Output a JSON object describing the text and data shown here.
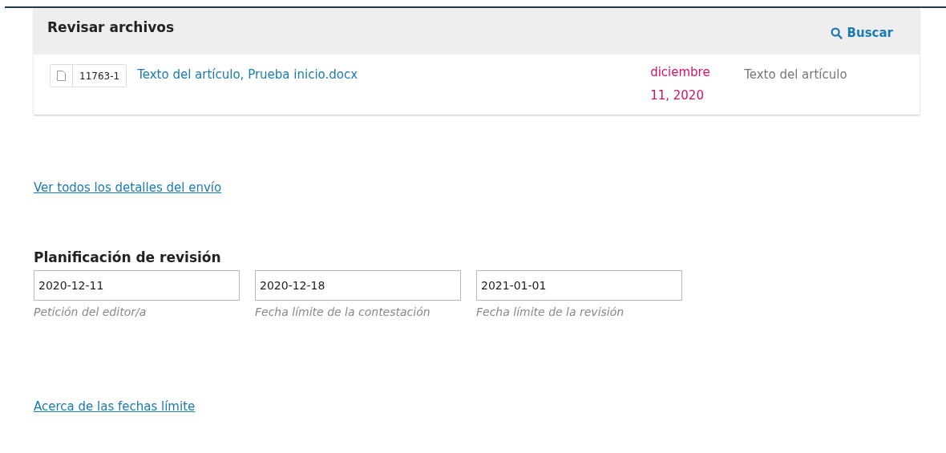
{
  "files_panel": {
    "title": "Revisar archivos",
    "search_link": "Buscar",
    "files": [
      {
        "id": "11763-1",
        "name": "Texto del artículo, Prueba inicio.docx",
        "date": "diciembre 11, 2020",
        "type": "Texto del artículo"
      }
    ]
  },
  "details_link": "Ver todos los detalles del envío",
  "schedule": {
    "title": "Planificación de revisión",
    "fields": [
      {
        "value": "2020-12-11",
        "caption": "Petición del editor/a"
      },
      {
        "value": "2020-12-18",
        "caption": "Fecha límite de la contestación"
      },
      {
        "value": "2021-01-01",
        "caption": "Fecha límite de la revisión"
      }
    ]
  },
  "deadlines_link": "Acerca de las fechas límite"
}
